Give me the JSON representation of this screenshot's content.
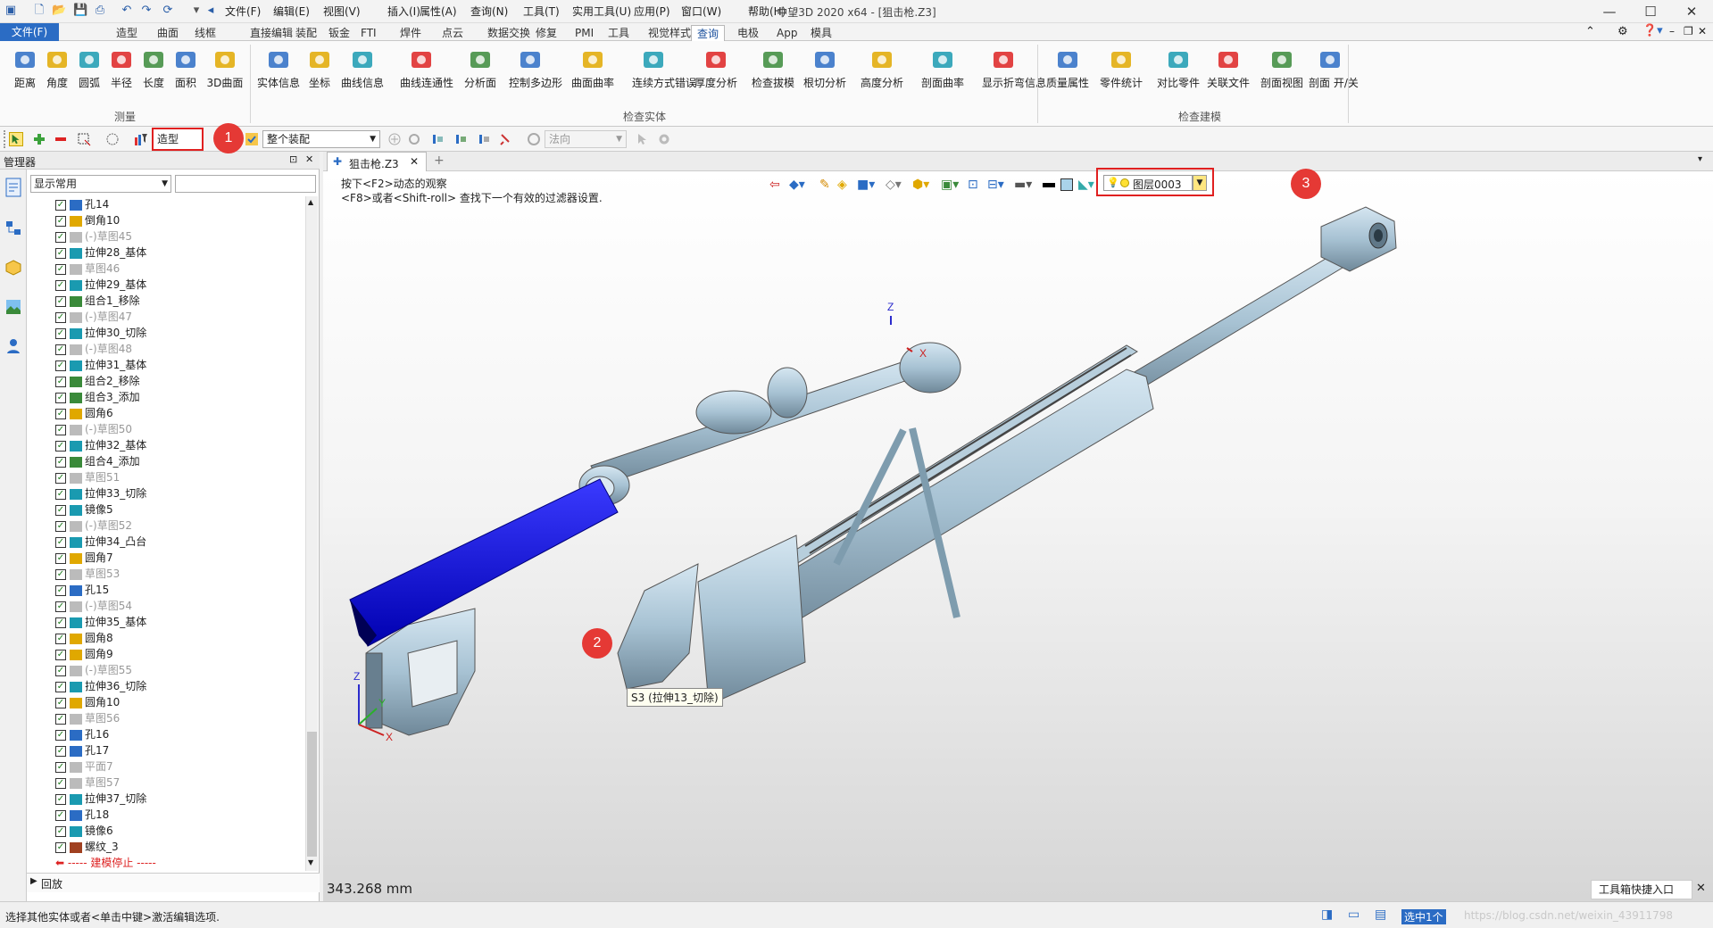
{
  "titlebar": {
    "title": "中望3D 2020 x64 - [狙击枪.Z3]",
    "menus": [
      "文件(F)",
      "编辑(E)",
      "视图(V)",
      "插入(I)",
      "属性(A)",
      "查询(N)",
      "工具(T)",
      "实用工具(U)",
      "应用(P)",
      "窗口(W)",
      "帮助(H)"
    ]
  },
  "ribbon_tabs": [
    "文件(F)",
    "造型",
    "曲面",
    "线框",
    "直接编辑",
    "装配",
    "钣金",
    "FTI",
    "焊件",
    "点云",
    "数据交换",
    "修复",
    "PMI",
    "工具",
    "视觉样式",
    "查询",
    "电极",
    "App",
    "模具"
  ],
  "ribbon": {
    "measure_group": "测量",
    "measure_buttons": [
      "距离",
      "角度",
      "圆弧",
      "半径",
      "长度",
      "面积",
      "3D曲面"
    ],
    "check_solid_group": "检查实体",
    "check_solid_buttons": [
      "实体信息",
      "坐标",
      "曲线信息",
      "曲线连通性",
      "分析面",
      "控制多边形",
      "曲面曲率",
      "连续方式错误",
      "厚度分析",
      "检查拔模",
      "根切分析",
      "高度分析",
      "剖面曲率",
      "显示折弯信息"
    ],
    "check_model_group": "检查建模",
    "check_model_buttons": [
      "质量属性",
      "零件统计",
      "对比零件",
      "关联文件",
      "剖面视图",
      "剖面 开/关"
    ]
  },
  "toolbar2": {
    "filter_value": "造型",
    "assembly_value": "整个装配",
    "direction_placeholder": "法向"
  },
  "manager": {
    "title": "管理器",
    "filter_value": "显示常用",
    "tree": [
      {
        "label": "孔14",
        "kind": "hole",
        "dim": false
      },
      {
        "label": "倒角10",
        "kind": "fillet",
        "dim": false
      },
      {
        "label": "(-)草图45",
        "kind": "sketch",
        "dim": true
      },
      {
        "label": "拉伸28_基体",
        "kind": "extrude",
        "dim": false
      },
      {
        "label": "草图46",
        "kind": "sketch",
        "dim": true
      },
      {
        "label": "拉伸29_基体",
        "kind": "extrude",
        "dim": false
      },
      {
        "label": "组合1_移除",
        "kind": "combine",
        "dim": false
      },
      {
        "label": "(-)草图47",
        "kind": "sketch",
        "dim": true
      },
      {
        "label": "拉伸30_切除",
        "kind": "extrude",
        "dim": false
      },
      {
        "label": "(-)草图48",
        "kind": "sketch",
        "dim": true
      },
      {
        "label": "拉伸31_基体",
        "kind": "extrude",
        "dim": false
      },
      {
        "label": "组合2_移除",
        "kind": "combine",
        "dim": false
      },
      {
        "label": "组合3_添加",
        "kind": "combine",
        "dim": false
      },
      {
        "label": "圆角6",
        "kind": "fillet",
        "dim": false
      },
      {
        "label": "(-)草图50",
        "kind": "sketch",
        "dim": true
      },
      {
        "label": "拉伸32_基体",
        "kind": "extrude",
        "dim": false
      },
      {
        "label": "组合4_添加",
        "kind": "combine",
        "dim": false
      },
      {
        "label": "草图51",
        "kind": "sketch",
        "dim": true
      },
      {
        "label": "拉伸33_切除",
        "kind": "extrude",
        "dim": false
      },
      {
        "label": "镜像5",
        "kind": "mirror",
        "dim": false
      },
      {
        "label": "(-)草图52",
        "kind": "sketch",
        "dim": true
      },
      {
        "label": "拉伸34_凸台",
        "kind": "extrude",
        "dim": false
      },
      {
        "label": "圆角7",
        "kind": "fillet",
        "dim": false
      },
      {
        "label": "草图53",
        "kind": "sketch",
        "dim": true
      },
      {
        "label": "孔15",
        "kind": "hole",
        "dim": false
      },
      {
        "label": "(-)草图54",
        "kind": "sketch",
        "dim": true
      },
      {
        "label": "拉伸35_基体",
        "kind": "extrude",
        "dim": false
      },
      {
        "label": "圆角8",
        "kind": "fillet",
        "dim": false
      },
      {
        "label": "圆角9",
        "kind": "fillet",
        "dim": false
      },
      {
        "label": "(-)草图55",
        "kind": "sketch",
        "dim": true
      },
      {
        "label": "拉伸36_切除",
        "kind": "extrude",
        "dim": false
      },
      {
        "label": "圆角10",
        "kind": "fillet",
        "dim": false
      },
      {
        "label": "草图56",
        "kind": "sketch",
        "dim": true
      },
      {
        "label": "孔16",
        "kind": "hole",
        "dim": false
      },
      {
        "label": "孔17",
        "kind": "hole",
        "dim": false
      },
      {
        "label": "平面7",
        "kind": "plane",
        "dim": true
      },
      {
        "label": "草图57",
        "kind": "sketch",
        "dim": true
      },
      {
        "label": "拉伸37_切除",
        "kind": "extrude",
        "dim": false
      },
      {
        "label": "孔18",
        "kind": "hole",
        "dim": false
      },
      {
        "label": "镜像6",
        "kind": "mirror",
        "dim": false
      },
      {
        "label": "螺纹_3",
        "kind": "thread",
        "dim": false
      }
    ],
    "stop_label": "----- 建模停止 -----",
    "rollback_label": "回放"
  },
  "viewport": {
    "doc_tab": "狙击枪.Z3",
    "hint1": "按下<F2>动态的观察",
    "hint2": "<F8>或者<Shift-roll> 查找下一个有效的过滤器设置.",
    "layer_value": "图层0003",
    "tooltip": "S3 (拉伸13_切除)",
    "measurement": "343.268 mm",
    "toolbox_entry": "工具箱快捷入口"
  },
  "status": {
    "message": "选择其他实体或者<单击中键>激活编辑选项.",
    "selected": "选中1个",
    "watermark": "https://blog.csdn.net/weixin_43911798"
  },
  "badges": [
    "1",
    "2",
    "3"
  ],
  "colors": {
    "accent": "#2b6cc4",
    "highlight": "#e02020",
    "selection": "#1a1aff",
    "model": "#a7c2d3"
  }
}
